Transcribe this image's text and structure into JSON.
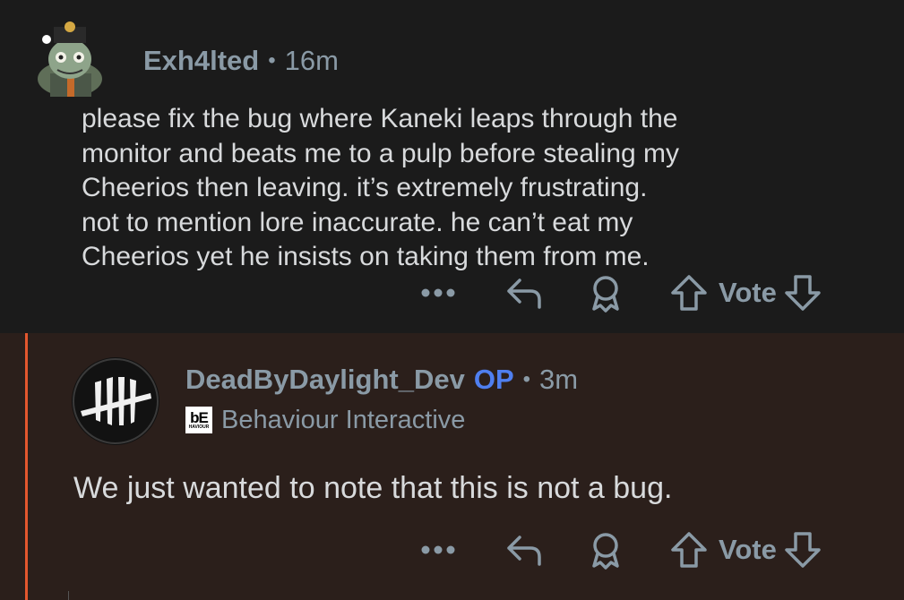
{
  "comments": [
    {
      "username": "Exh4lted",
      "time": "16m",
      "body": "please fix the bug where Kaneki leaps through the monitor and beats me to a pulp before stealing my Cheerios then leaving. it’s extremely frustrating. not to mention lore inaccurate. he can’t eat my Cheerios yet he insists on taking them from me.",
      "body_lines": [
        "please fix the bug where Kaneki leaps through the",
        "monitor and beats me to a pulp before stealing my",
        "Cheerios then leaving. it’s extremely frustrating.",
        "not to mention lore inaccurate. he can’t eat my",
        "Cheerios yet he insists on taking them from me."
      ],
      "vote_label": "Vote",
      "avatar_icon": "character-avatar-icon"
    },
    {
      "username": "DeadByDaylight_Dev",
      "op_badge": "OP",
      "time": "3m",
      "flair_badge_text": "bE",
      "flair_badge_subtext": "HAVIOUR",
      "flair_text": "Behaviour Interactive",
      "body": "We just wanted to note that this is not a bug.",
      "vote_label": "Vote",
      "avatar_icon": "dead-by-daylight-logo-icon"
    }
  ],
  "separator": "•",
  "icons": [
    "more-icon",
    "reply-icon",
    "award-icon",
    "upvote-icon",
    "downvote-icon"
  ],
  "colors": {
    "background": "#1b1b1b",
    "op_background": "#2b1f1b",
    "op_accent": "#e4572e",
    "op_badge": "#4f7ff0",
    "meta_text": "#8a9aa6",
    "body_text": "#d8dadc"
  }
}
